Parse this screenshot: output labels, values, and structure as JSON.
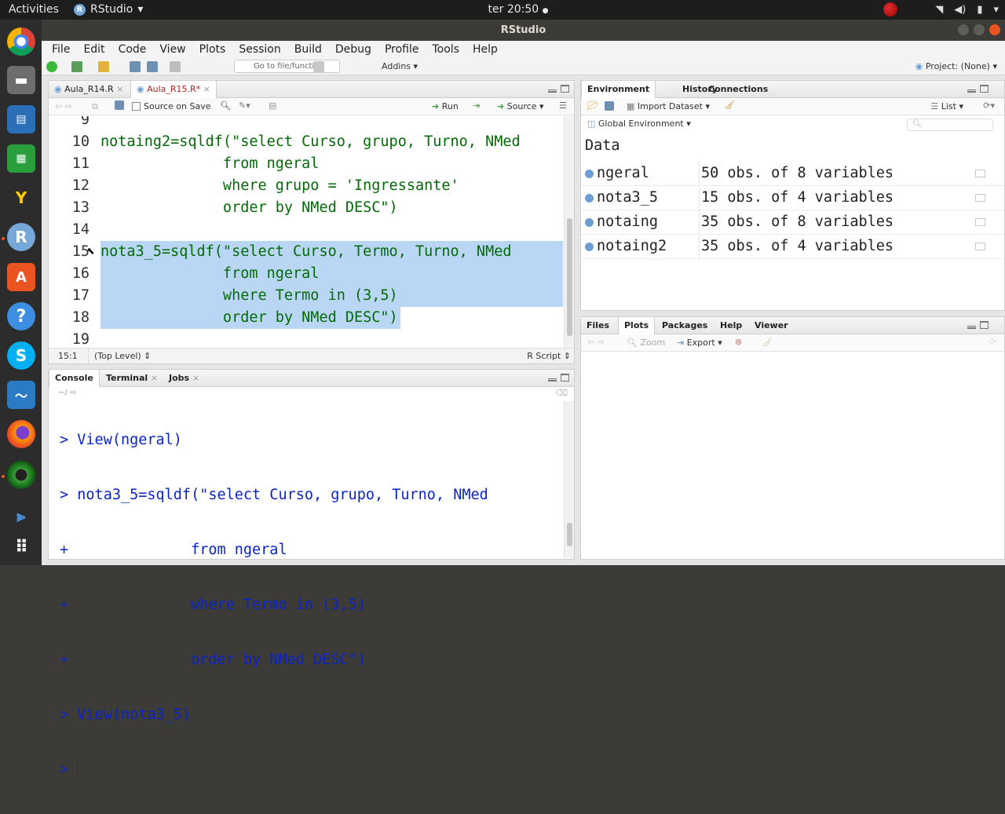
{
  "topbar": {
    "activities": "Activities",
    "app_name": "RStudio",
    "clock": "ter 20:50"
  },
  "window": {
    "title": "RStudio"
  },
  "menu": [
    "File",
    "Edit",
    "Code",
    "View",
    "Plots",
    "Session",
    "Build",
    "Debug",
    "Profile",
    "Tools",
    "Help"
  ],
  "toolbar": {
    "goto_placeholder": "Go to file/function",
    "addins": "Addins",
    "project": "Project: (None)"
  },
  "editor": {
    "tabs": [
      "Aula_R14.R",
      "Aula_R15.R*"
    ],
    "source_on_save": "Source on Save",
    "run": "Run",
    "source": "Source",
    "lines": [
      {
        "n": "9",
        "text": ""
      },
      {
        "n": "10",
        "text": "notaing2=sqldf(\"select Curso, grupo, Turno, NMed"
      },
      {
        "n": "11",
        "text": "              from ngeral"
      },
      {
        "n": "12",
        "text": "              where grupo = 'Ingressante'"
      },
      {
        "n": "13",
        "text": "              order by NMed DESC\")"
      },
      {
        "n": "14",
        "text": ""
      },
      {
        "n": "15",
        "text": "nota3_5=sqldf(\"select Curso, Termo, Turno, NMed"
      },
      {
        "n": "16",
        "text": "              from ngeral"
      },
      {
        "n": "17",
        "text": "              where Termo in (3,5)"
      },
      {
        "n": "18",
        "text": "              order by NMed DESC\")"
      },
      {
        "n": "19",
        "text": ""
      }
    ],
    "status_pos": "15:1",
    "status_scope": "(Top Level)",
    "status_type": "R Script"
  },
  "console": {
    "tabs": [
      "Console",
      "Terminal",
      "Jobs"
    ],
    "path": "~/",
    "lines": [
      "> View(ngeral)",
      "> nota3_5=sqldf(\"select Curso, grupo, Turno, NMed",
      "+              from ngeral",
      "+              where Termo in (3,5)",
      "+              order by NMed DESC\")",
      "> View(nota3_5)",
      "> "
    ]
  },
  "environment": {
    "tabs": [
      "Environment",
      "History",
      "Connections"
    ],
    "import_dataset": "Import Dataset",
    "list": "List",
    "global_env": "Global Environment",
    "section": "Data",
    "rows": [
      {
        "name": "ngeral",
        "value": "50 obs. of 8 variables"
      },
      {
        "name": "nota3_5",
        "value": "15 obs. of 4 variables"
      },
      {
        "name": "notaing",
        "value": "35 obs. of 8 variables"
      },
      {
        "name": "notaing2",
        "value": "35 obs. of 4 variables"
      }
    ]
  },
  "files": {
    "tabs": [
      "Files",
      "Plots",
      "Packages",
      "Help",
      "Viewer"
    ],
    "zoom": "Zoom",
    "export": "Export"
  }
}
